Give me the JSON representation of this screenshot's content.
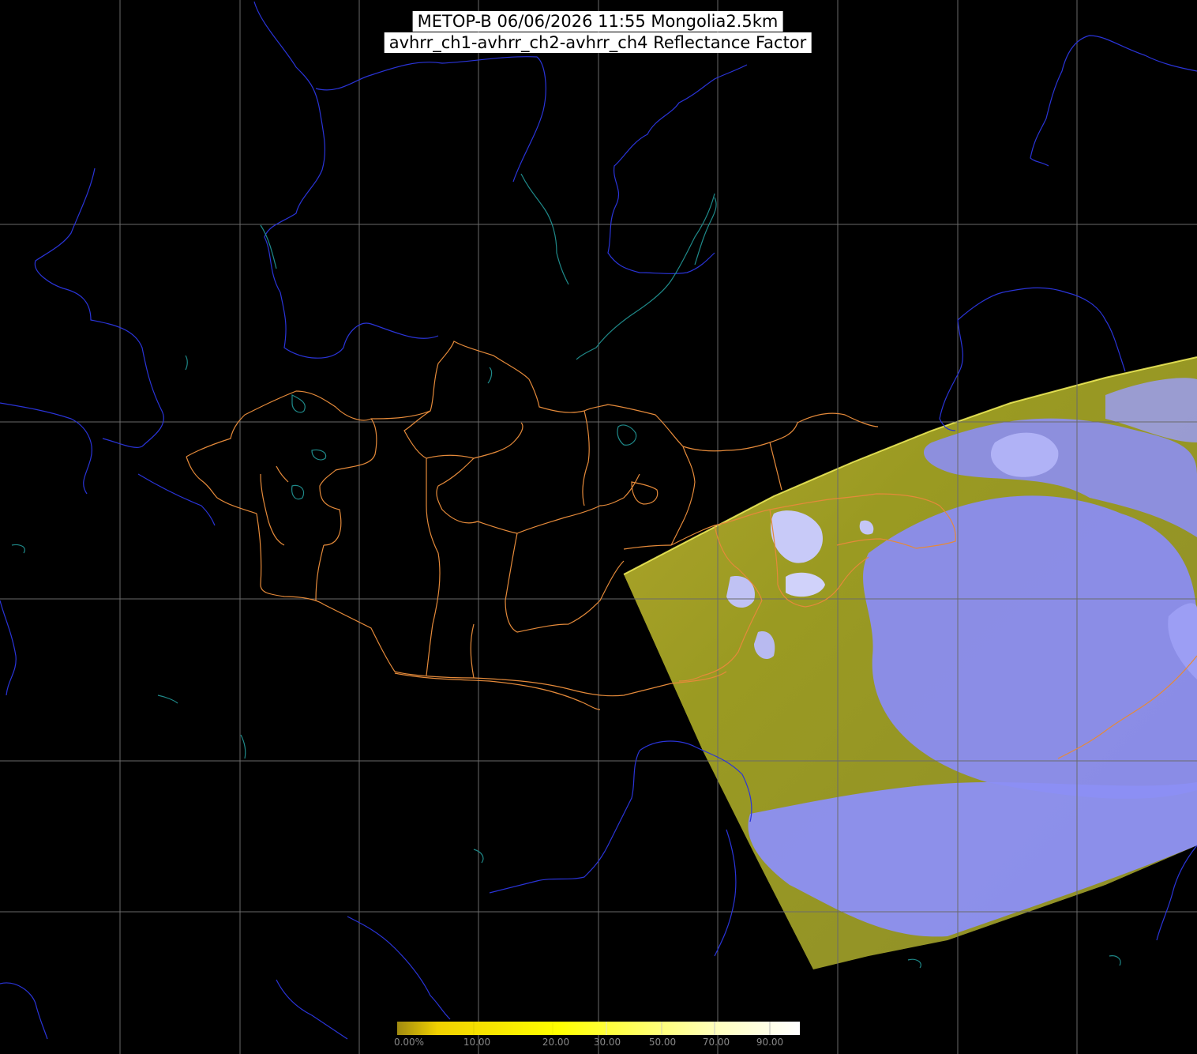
{
  "title": {
    "line1": "METOP-B 06/06/2026 11:55 Mongolia2.5km",
    "line2": "avhrr_ch1-avhrr_ch2-avhrr_ch4 Reflectance Factor"
  },
  "colors": {
    "background": "#000000",
    "graticule": "#6a6a6a",
    "coastline": "#2a34d8",
    "lakes": "#1f8a8a",
    "borders": "#e58a3a",
    "land_reflectance": "#9c9c1a",
    "cloud_reflectance": "#8c90f2"
  },
  "legend": {
    "labels": [
      "0.00%",
      "10.00",
      "20.00",
      "30.00",
      "50.00",
      "70.00",
      "90.00"
    ],
    "colors": [
      "#a08a10",
      "#f4d800",
      "#ffff00",
      "#ffff40",
      "#ffff90",
      "#ffffd0",
      "#ffffff"
    ]
  }
}
